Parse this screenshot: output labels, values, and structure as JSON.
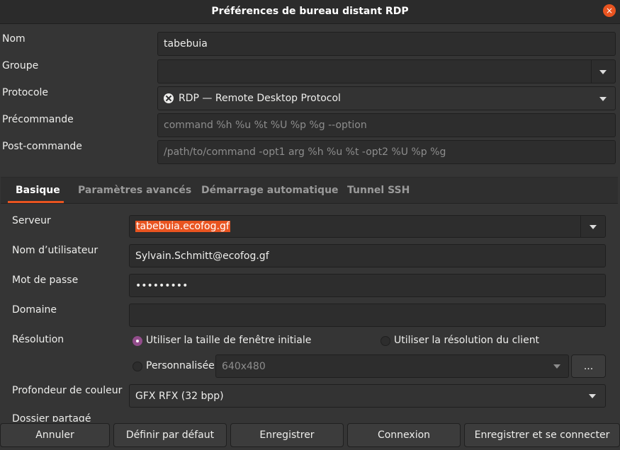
{
  "window": {
    "title": "Préférences de bureau distant RDP",
    "close_icon": "×"
  },
  "general": {
    "name_label": "Nom",
    "name_value": "tabebuia",
    "group_label": "Groupe",
    "group_value": "",
    "protocol_label": "Protocole",
    "protocol_value": "RDP — Remote Desktop Protocol",
    "precommand_label": "Précommande",
    "precommand_placeholder": "command %h %u %t %U %p %g --option",
    "postcommand_label": "Post-commande",
    "postcommand_placeholder": "/path/to/command -opt1 arg %h %u %t -opt2 %U %p %g"
  },
  "tabs": [
    {
      "label": "Basique",
      "active": true
    },
    {
      "label": "Paramètres avancés",
      "active": false
    },
    {
      "label": "Démarrage automatique",
      "active": false
    },
    {
      "label": "Tunnel SSH",
      "active": false
    }
  ],
  "basic": {
    "server_label": "Serveur",
    "server_value": "tabebuia.ecofog.gf",
    "username_label": "Nom d’utilisateur",
    "username_value": "Sylvain.Schmitt@ecofog.gf",
    "password_label": "Mot de passe",
    "password_value": "•••••••••",
    "domain_label": "Domaine",
    "domain_value": "",
    "resolution_label": "Résolution",
    "resolution_options": {
      "initial": "Utiliser la taille de fenêtre initiale",
      "client": "Utiliser la résolution du client",
      "custom": "Personnalisée"
    },
    "resolution_selected": "initial",
    "custom_resolution_value": "640x480",
    "ellipsis_button": "...",
    "color_depth_label": "Profondeur de couleur",
    "color_depth_value": "GFX RFX (32 bpp)",
    "shared_folder_label": "Dossier partagé"
  },
  "buttons": {
    "cancel": "Annuler",
    "set_default": "Définir par défaut",
    "save": "Enregistrer",
    "connect": "Connexion",
    "save_and_connect": "Enregistrer et se connecter"
  },
  "colors": {
    "accent": "#e95420",
    "radio_selected": "#924d8b",
    "background": "#353535",
    "field": "#2d2d2d"
  },
  "icons": {
    "close": "close-icon",
    "dropdown": "chevron-down-icon",
    "protocol": "rdp-protocol-icon"
  }
}
